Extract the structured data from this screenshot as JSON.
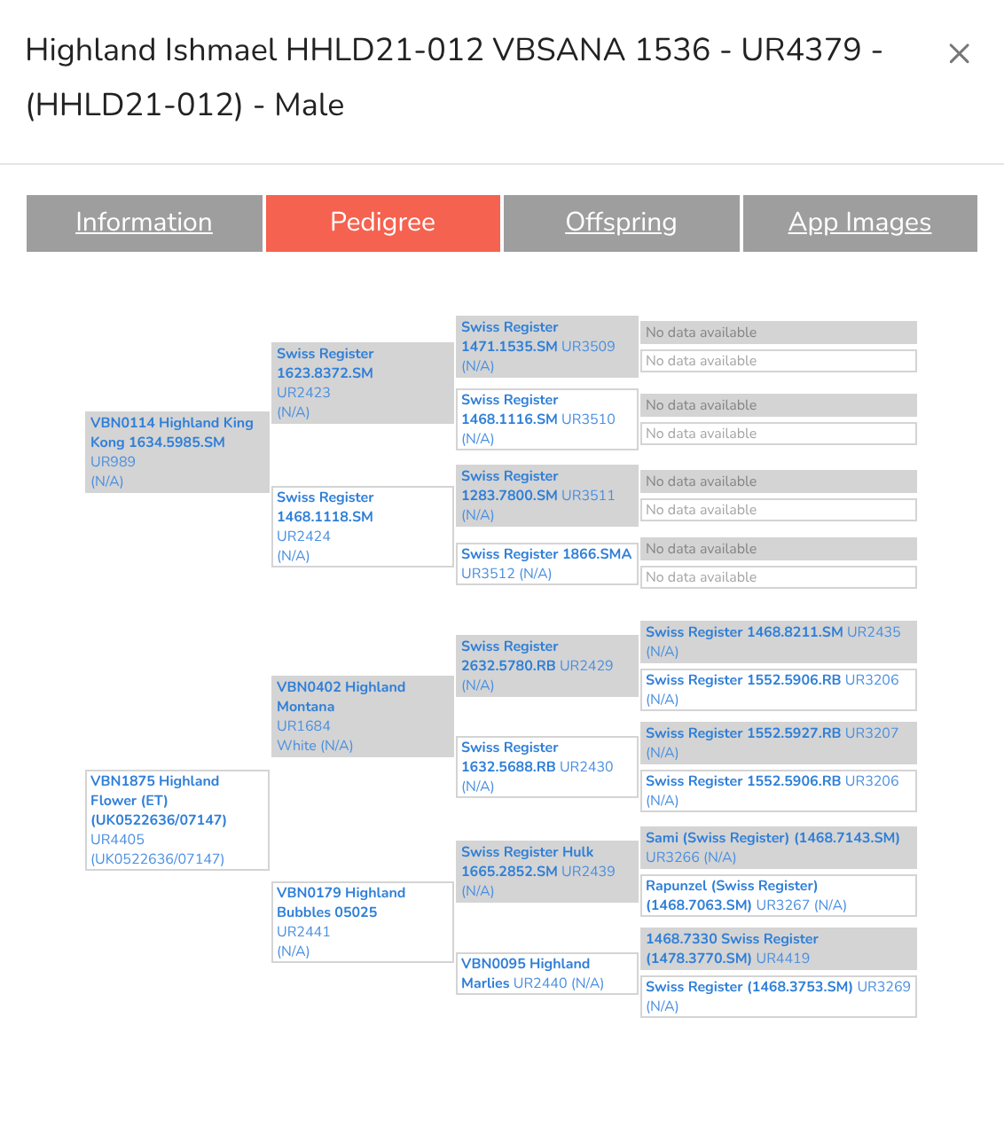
{
  "title": "Highland Ishmael HHLD21-012 VBSANA 1536 - UR4379 - (HHLD21-012) - Male",
  "close_label": "×",
  "tabs": [
    {
      "label": "Information",
      "selected": false
    },
    {
      "label": "Pedigree",
      "selected": true
    },
    {
      "label": "Offspring",
      "selected": false
    },
    {
      "label": "App Images",
      "selected": false
    }
  ],
  "pedigree": [
    {
      "kind": "sire",
      "name": "VBN0114 Highland King Kong 1634.5985.SM",
      "reg": "UR989",
      "note": "(N/A)",
      "children": [
        {
          "kind": "sire",
          "name": "Swiss Register 1623.8372.SM",
          "reg": "UR2423",
          "note": "(N/A)",
          "children": [
            {
              "kind": "sire",
              "name": "Swiss Register 1471.1535.SM",
              "reg": "UR3509",
              "note": "(N/A)",
              "children": [
                {
                  "kind": "sire",
                  "missing": "No data available"
                },
                {
                  "kind": "dam",
                  "missing": "No data available"
                }
              ]
            },
            {
              "kind": "dam",
              "name": "Swiss Register 1468.1116.SM",
              "reg": "UR3510",
              "note": "(N/A)",
              "children": [
                {
                  "kind": "sire",
                  "missing": "No data available"
                },
                {
                  "kind": "dam",
                  "missing": "No data available"
                }
              ]
            }
          ]
        },
        {
          "kind": "dam",
          "name": "Swiss Register 1468.1118.SM",
          "reg": "UR2424",
          "note": "(N/A)",
          "children": [
            {
              "kind": "sire",
              "name": "Swiss Register 1283.7800.SM",
              "reg": "UR3511",
              "note": "(N/A)",
              "children": [
                {
                  "kind": "sire",
                  "missing": "No data available"
                },
                {
                  "kind": "dam",
                  "missing": "No data available"
                }
              ]
            },
            {
              "kind": "dam",
              "name": "Swiss Register 1866.SMA",
              "reg": "UR3512",
              "note": "(N/A)",
              "children": [
                {
                  "kind": "sire",
                  "missing": "No data available"
                },
                {
                  "kind": "dam",
                  "missing": "No data available"
                }
              ]
            }
          ]
        }
      ]
    },
    {
      "kind": "dam",
      "name": "VBN1875 Highland Flower (ET) (UK0522636/07147)",
      "reg": "UR4405",
      "note": "(UK0522636/07147)",
      "children": [
        {
          "kind": "sire",
          "name": "VBN0402 Highland Montana",
          "reg": "UR1684",
          "note": "White (N/A)",
          "children": [
            {
              "kind": "sire",
              "name": "Swiss Register 2632.5780.RB",
              "reg": "UR2429",
              "note": "(N/A)",
              "children": [
                {
                  "kind": "sire",
                  "name": "Swiss Register 1468.8211.SM",
                  "reg": "UR2435",
                  "note": "(N/A)"
                },
                {
                  "kind": "dam",
                  "name": "Swiss Register 1552.5906.RB",
                  "reg": "UR3206",
                  "note": "(N/A)"
                }
              ]
            },
            {
              "kind": "dam",
              "name": "Swiss Register 1632.5688.RB",
              "reg": "UR2430",
              "note": "(N/A)",
              "children": [
                {
                  "kind": "sire",
                  "name": "Swiss Register 1552.5927.RB",
                  "reg": "UR3207",
                  "note": "(N/A)"
                },
                {
                  "kind": "dam",
                  "name": "Swiss Register 1552.5906.RB",
                  "reg": "UR3206",
                  "note": "(N/A)"
                }
              ]
            }
          ]
        },
        {
          "kind": "dam",
          "name": "VBN0179 Highland Bubbles 05025",
          "reg": "UR2441",
          "note": "(N/A)",
          "children": [
            {
              "kind": "sire",
              "name": "Swiss Register Hulk 1665.2852.SM",
              "reg": "UR2439",
              "note": "(N/A)",
              "children": [
                {
                  "kind": "sire",
                  "name": "Sami (Swiss Register) (1468.7143.SM)",
                  "reg": "UR3266",
                  "note": "(N/A)"
                },
                {
                  "kind": "dam",
                  "name": "Rapunzel (Swiss Register) (1468.7063.SM)",
                  "reg": "UR3267",
                  "note": "(N/A)"
                }
              ]
            },
            {
              "kind": "dam",
              "name": "VBN0095 Highland Marlies",
              "reg": "UR2440",
              "note": "(N/A)",
              "children": [
                {
                  "kind": "sire",
                  "name": "1468.7330 Swiss Register (1478.3770.SM)",
                  "reg": "UR4419"
                },
                {
                  "kind": "dam",
                  "name": "Swiss Register (1468.3753.SM)",
                  "reg": "UR3269",
                  "note": "(N/A)"
                }
              ]
            }
          ]
        }
      ]
    }
  ]
}
